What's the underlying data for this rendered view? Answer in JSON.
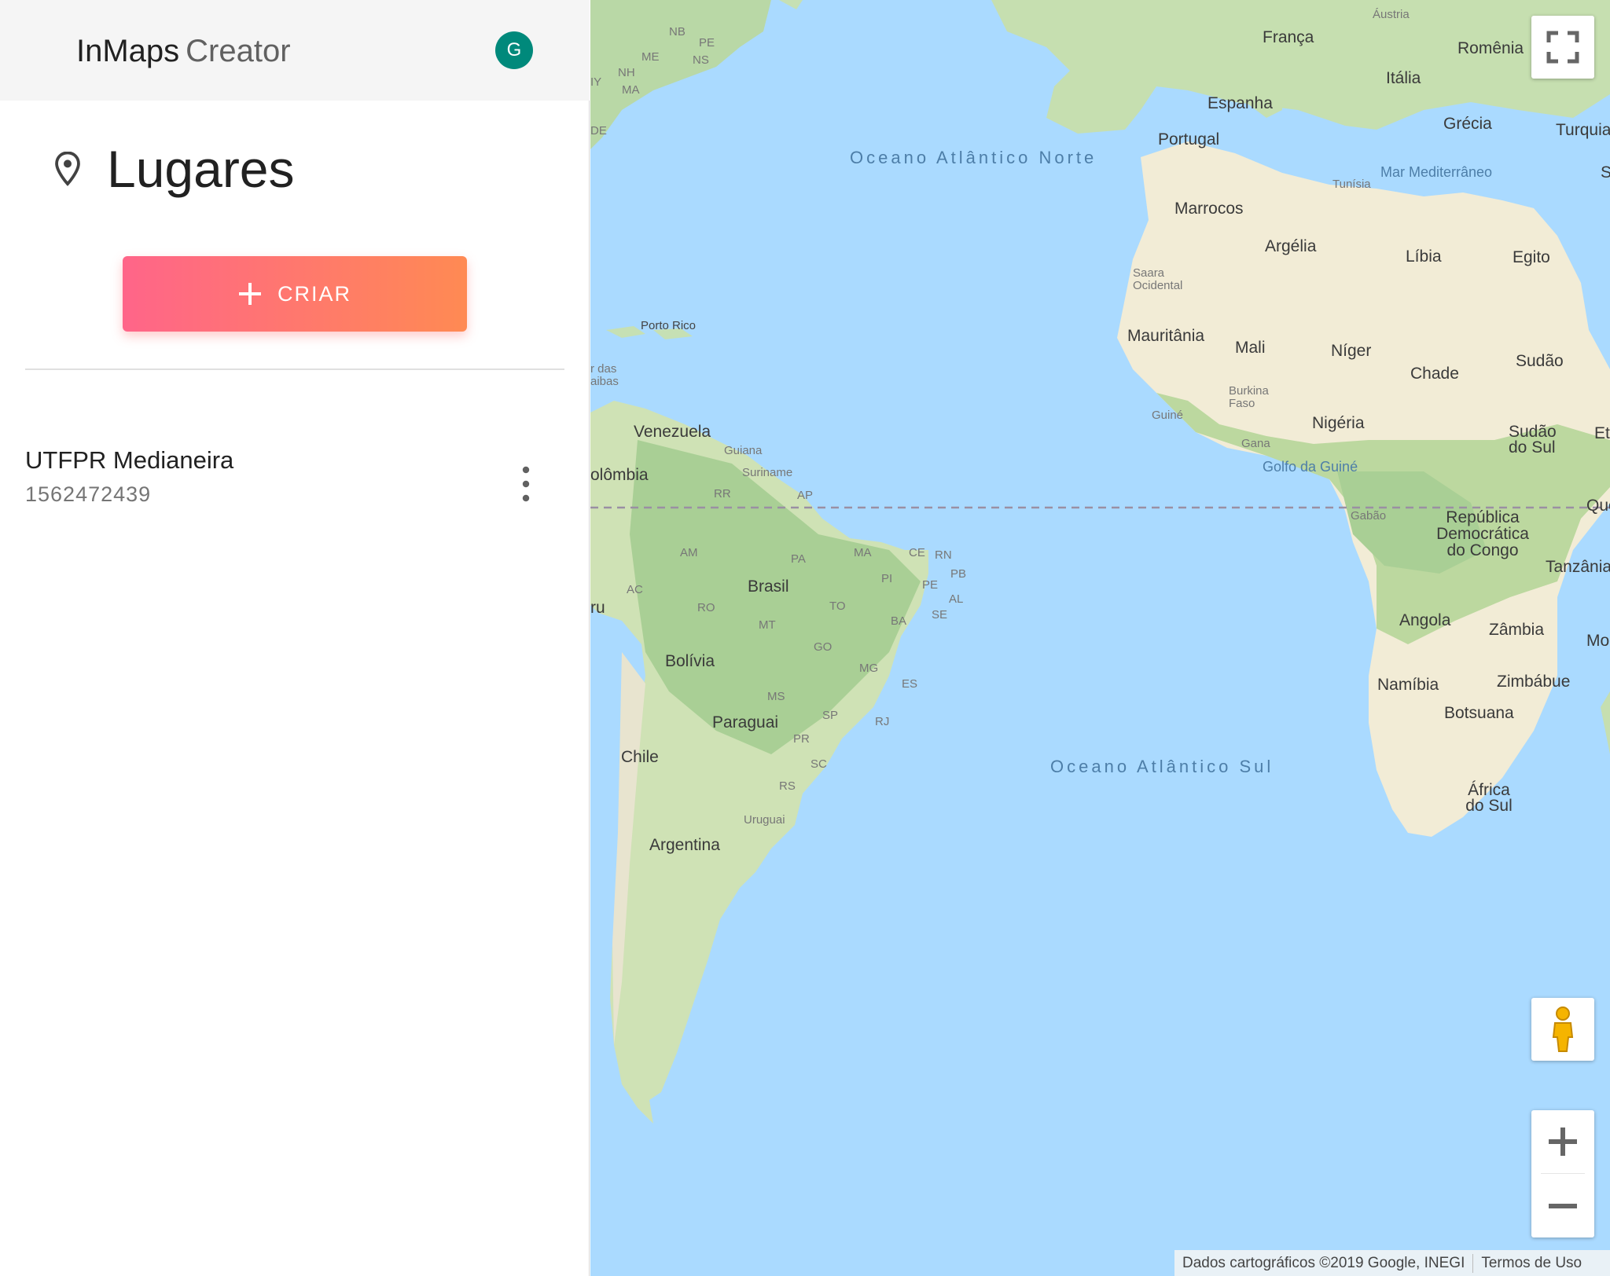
{
  "app": {
    "brand_strong": "InMaps",
    "brand_light": "Creator",
    "avatar_initial": "G",
    "colors": {
      "avatar": "#00897b",
      "button_from": "#ff6589",
      "button_to": "#ff8a53"
    }
  },
  "sidebar": {
    "title": "Lugares",
    "title_icon": "map-pin-icon",
    "create_label": "CRIAR",
    "places": [
      {
        "name": "UTFPR Medianeira",
        "subtitle": "1562472439",
        "menu_icon": "more-vert-icon"
      }
    ]
  },
  "map": {
    "attribution": "Dados cartográficos ©2019 Google, INEGI",
    "terms": "Termos de Uso",
    "oceans": {
      "north_atlantic": "Oceano Atlântico Norte",
      "south_atlantic": "Oceano Atlântico Sul",
      "gulf_guinea": "Golfo da Guiné",
      "mediterranean": "Mar Mediterrâneo"
    },
    "countries": {
      "franca": "França",
      "austria": "Áustria",
      "romenia": "Romênia",
      "italia": "Itália",
      "espanha": "Espanha",
      "portugal": "Portugal",
      "grecia": "Grécia",
      "turquia": "Turquia",
      "tunisia": "Tunísia",
      "marrocos": "Marrocos",
      "argelia": "Argélia",
      "libia": "Líbia",
      "egito": "Egito",
      "saara": "Saara Ocidental",
      "mauritania": "Mauritânia",
      "mali": "Mali",
      "niger": "Níger",
      "chade": "Chade",
      "sudao": "Sudão",
      "burkina": "Burkina Faso",
      "guine": "Guiné",
      "gana": "Gana",
      "nigeria": "Nigéria",
      "sudao_sul": "Sudão do Sul",
      "gabao": "Gabão",
      "rdc": "República Democrática do Congo",
      "tanzania": "Tanzânia",
      "angola": "Angola",
      "zambia": "Zâmbia",
      "namibia": "Namíbia",
      "zimbabue": "Zimbábue",
      "botsuana": "Botsuana",
      "africa_sul": "África do Sul",
      "porto_rico": "Porto Rico",
      "venezuela": "Venezuela",
      "guiana": "Guiana",
      "suriname": "Suriname",
      "colombia": "olômbia",
      "brasil": "Brasil",
      "bolivia": "Bolívia",
      "paraguai": "Paraguai",
      "chile": "Chile",
      "argentina": "Argentina",
      "uruguai": "Uruguai",
      "peru": "ru",
      "caraibas": "r das aibas",
      "quenia": "Quê",
      "moc": "Moç",
      "et": "Et",
      "s_edge": "S"
    },
    "states": {
      "nb": "NB",
      "pe_ca": "PE",
      "me": "ME",
      "ns": "NS",
      "nh": "NH",
      "ma_us": "MA",
      "ny": "IY",
      "de": "DE",
      "rr": "RR",
      "ap": "AP",
      "am": "AM",
      "pa": "PA",
      "ma": "MA",
      "ce": "CE",
      "rn": "RN",
      "pb": "PB",
      "pi": "PI",
      "pe": "PE",
      "al": "AL",
      "ac": "AC",
      "ro": "RO",
      "to": "TO",
      "ba": "BA",
      "se": "SE",
      "mt": "MT",
      "go": "GO",
      "mg": "MG",
      "es": "ES",
      "ms": "MS",
      "sp": "SP",
      "rj": "RJ",
      "pr": "PR",
      "sc": "SC",
      "rs": "RS"
    }
  }
}
